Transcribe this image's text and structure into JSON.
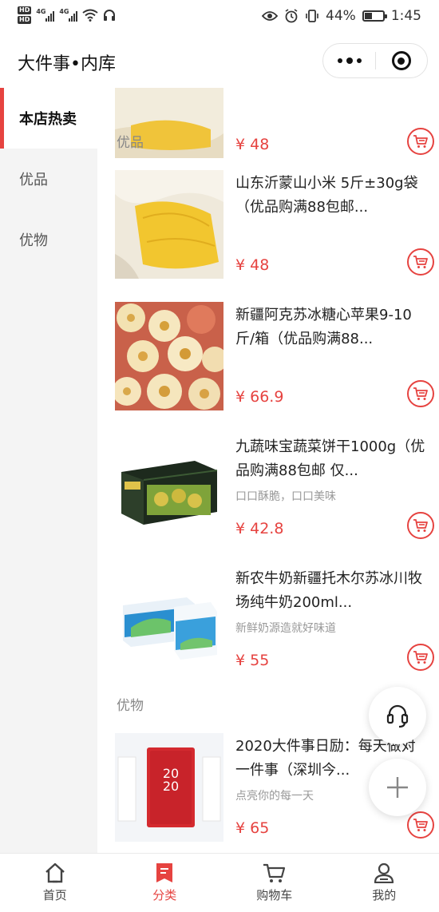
{
  "status_bar": {
    "network_badges": [
      "HD",
      "HD"
    ],
    "signal_labels": [
      "4G",
      "4G"
    ],
    "battery_text": "44%",
    "battery_level": 0.44,
    "time": "1:45"
  },
  "header": {
    "title": "大件事•内库"
  },
  "sidebar": {
    "items": [
      {
        "label": "本店热卖",
        "active": true
      },
      {
        "label": "优品",
        "active": false
      },
      {
        "label": "优物",
        "active": false
      }
    ]
  },
  "main": {
    "top_partial_price": "¥ 48",
    "sections": [
      {
        "title": "优品",
        "products": [
          {
            "name": "山东沂蒙山小米 5斤±30g袋（优品购满88包邮...",
            "desc": "",
            "price": "¥ 48"
          },
          {
            "name": "新疆阿克苏冰糖心苹果9-10斤/箱（优品购满88...",
            "desc": "",
            "price": "¥ 66.9"
          },
          {
            "name": "九蔬味宝蔬菜饼干1000g（优品购满88包邮 仅...",
            "desc": "口口酥脆，口口美味",
            "price": "¥ 42.8"
          },
          {
            "name": "新农牛奶新疆托木尔苏冰川牧场纯牛奶200ml...",
            "desc": "新鲜奶源造就好味道",
            "price": "¥ 55"
          }
        ]
      },
      {
        "title": "优物",
        "products": [
          {
            "name": "2020大件事日励：每天做对一件事（深圳今...",
            "desc": "点亮你的每一天",
            "price": "¥ 65"
          }
        ]
      }
    ]
  },
  "tabbar": {
    "items": [
      {
        "label": "首页",
        "icon": "home-icon",
        "active": false
      },
      {
        "label": "分类",
        "icon": "category-icon",
        "active": true
      },
      {
        "label": "购物车",
        "icon": "cart-icon",
        "active": false
      },
      {
        "label": "我的",
        "icon": "profile-icon",
        "active": false
      }
    ]
  },
  "colors": {
    "accent": "#e64340",
    "sidebar_bg": "#f4f4f4"
  }
}
